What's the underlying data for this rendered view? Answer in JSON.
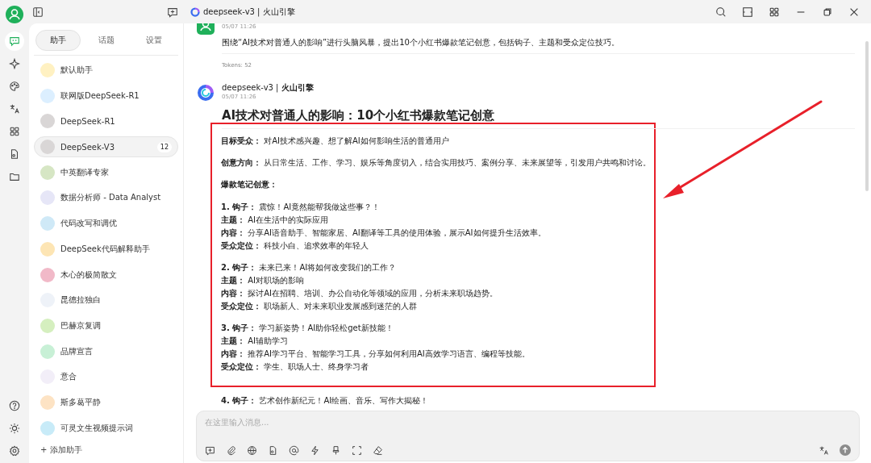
{
  "window": {
    "title": "deepseek-v3 | 火山引擎"
  },
  "sidebar": {
    "tabs": [
      {
        "label": "助手",
        "selected": true
      },
      {
        "label": "话题",
        "selected": false
      },
      {
        "label": "设置",
        "selected": false
      }
    ],
    "assistants": [
      {
        "name": "默认助手",
        "color": "#fff1c2",
        "selected": false
      },
      {
        "name": "联网版DeepSeek-R1",
        "color": "#dcefff",
        "selected": false
      },
      {
        "name": "DeepSeek-R1",
        "color": "#d9d6d6",
        "selected": false
      },
      {
        "name": "DeepSeek-V3",
        "color": "#d9d6d6",
        "selected": true,
        "badge": "12"
      },
      {
        "name": "中英翻译专家",
        "color": "#d6e6c4",
        "selected": false
      },
      {
        "name": "数据分析师 - Data Analyst",
        "color": "#e6e6f7",
        "selected": false
      },
      {
        "name": "代码改写和调优",
        "color": "#cfe9f7",
        "selected": false
      },
      {
        "name": "DeepSeek代码解释助手",
        "color": "#fde5b4",
        "selected": false
      },
      {
        "name": "木心的极简散文",
        "color": "#f1b9c8",
        "selected": false
      },
      {
        "name": "昆德拉独白",
        "color": "#eef2f8",
        "selected": false
      },
      {
        "name": "巴赫京复调",
        "color": "#d5efbf",
        "selected": false
      },
      {
        "name": "品牌宣言",
        "color": "#c8f0d6",
        "selected": false
      },
      {
        "name": "意合",
        "color": "#f2eef8",
        "selected": false
      },
      {
        "name": "斯多葛平静",
        "color": "#fde3c4",
        "selected": false
      },
      {
        "name": "可灵文生视频提示词",
        "color": "#c8ebf8",
        "selected": false
      }
    ],
    "add_button": "+ 添加助手"
  },
  "messages": [
    {
      "kind": "user",
      "time": "05/07 11:26",
      "text": "围绕“AI技术对普通人的影响”进行头脑风暴，提出10个小红书爆款笔记创意，包括钩子、主题和受众定位技巧。",
      "tokens": "Tokens: 52"
    },
    {
      "kind": "assistant",
      "sender": "deepseek-v3 | **火山引擎**",
      "time": "05/07 11:26",
      "heading": "AI技术对普通人的影响：10个小红书爆款笔记创意",
      "intro": [
        "**目标受众：** 对AI技术感兴趣、想了解AI如何影响生活的普通用户",
        "**创意方向：** 从日常生活、工作、学习、娱乐等角度切入，结合实用技巧、案例分享、未来展望等，引发用户共鸣和讨论。",
        "**爆款笔记创意：**"
      ],
      "ideas": [
        [
          "**1. 钩子：** 震惊！AI竟然能帮我做这些事？！",
          "**主题：** AI在生活中的实际应用",
          "**内容：** 分享AI语音助手、智能家居、AI翻译等工具的使用体验，展示AI如何提升生活效率。",
          "**受众定位：** 科技小白、追求效率的年轻人"
        ],
        [
          "**2. 钩子：** 未来已来！AI将如何改变我们的工作？",
          "**主题：** AI对职场的影响",
          "**内容：** 探讨AI在招聘、培训、办公自动化等领域的应用，分析未来职场趋势。",
          "**受众定位：** 职场新人、对未来职业发展感到迷茫的人群"
        ],
        [
          "**3. 钩子：** 学习新姿势！AI助你轻松get新技能！",
          "**主题：** AI辅助学习",
          "**内容：** 推荐AI学习平台、智能学习工具，分享如何利用AI高效学习语言、编程等技能。",
          "**受众定位：** 学生、职场人士、终身学习者"
        ]
      ],
      "after": [
        "**4. 钩子：** 艺术创作新纪元！AI绘画、音乐、写作大揭秘！"
      ]
    }
  ],
  "composer": {
    "placeholder": "在这里输入消息..."
  }
}
